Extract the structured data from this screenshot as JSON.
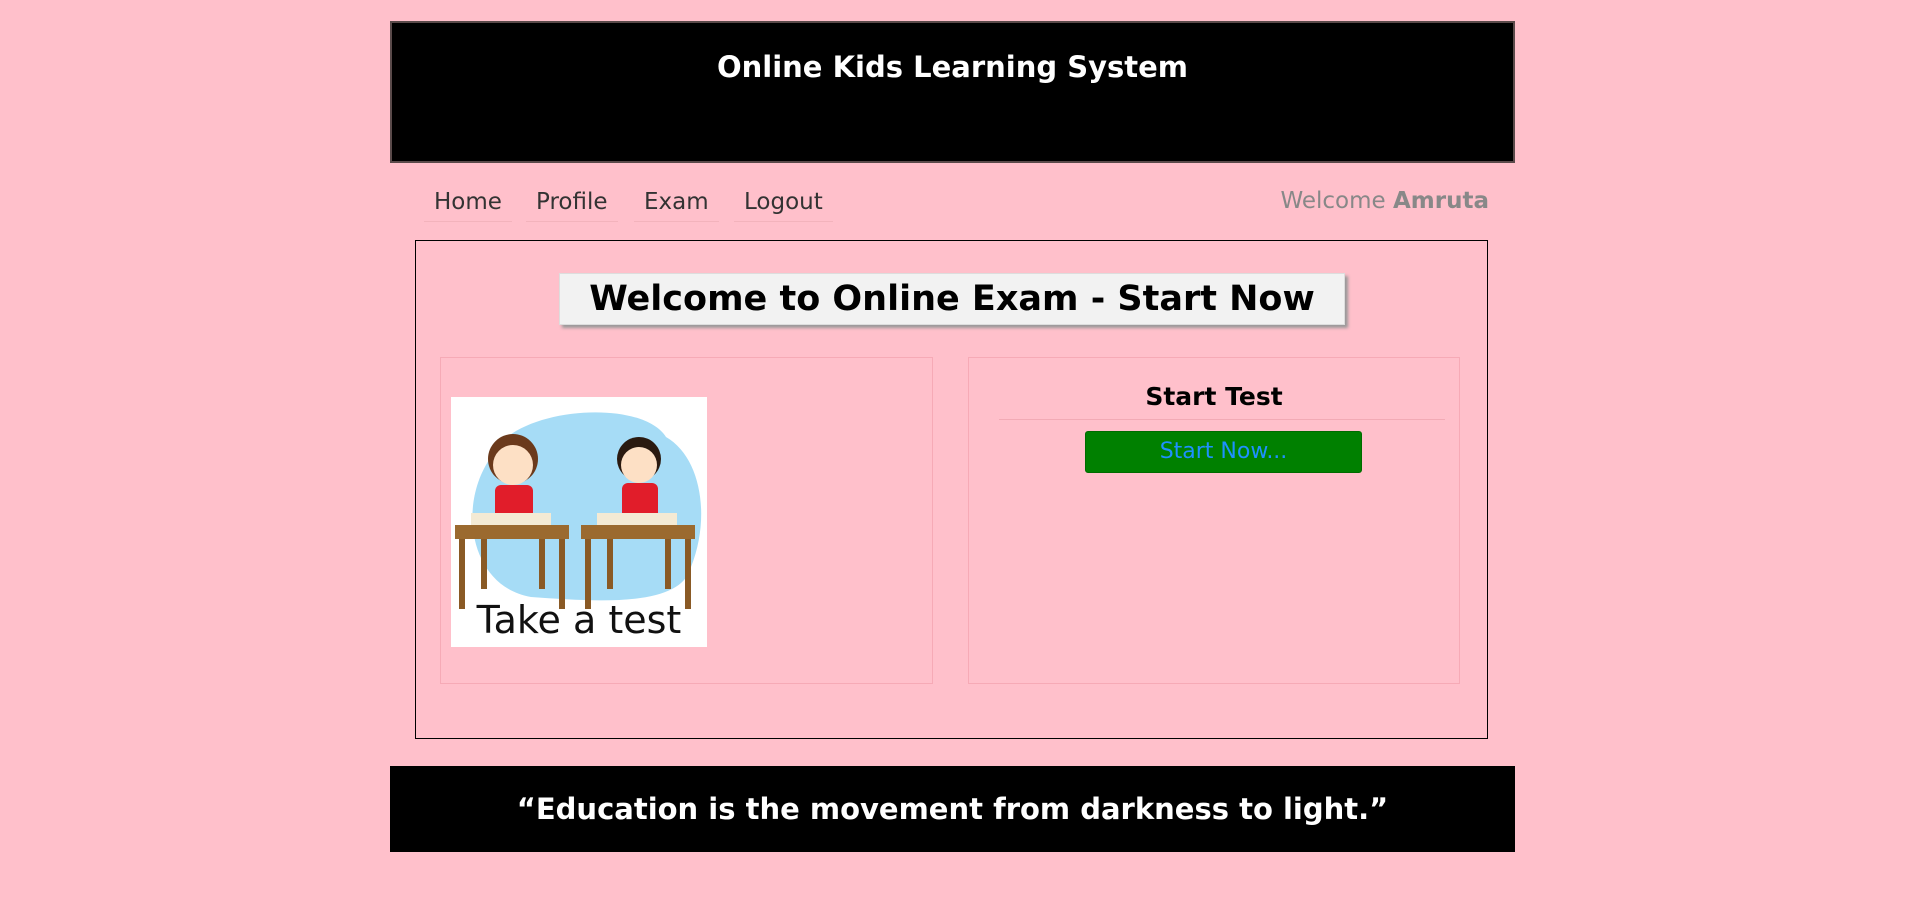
{
  "header": {
    "title": "Online Kids Learning System"
  },
  "nav": {
    "items": [
      {
        "label": "Home"
      },
      {
        "label": "Profile"
      },
      {
        "label": "Exam"
      },
      {
        "label": "Logout"
      }
    ],
    "welcome_prefix": "Welcome",
    "username": "Amruta"
  },
  "main": {
    "title": "Welcome to Online Exam - Start Now",
    "image_caption": "Take a test",
    "start_heading": "Start Test",
    "start_button": "Start Now..."
  },
  "footer": {
    "quote": "“Education is the movement from darkness to light.”"
  },
  "colors": {
    "background": "#ffc0cb",
    "header_bg": "#000000",
    "button_bg": "#008000",
    "button_text": "#1e90ff"
  }
}
